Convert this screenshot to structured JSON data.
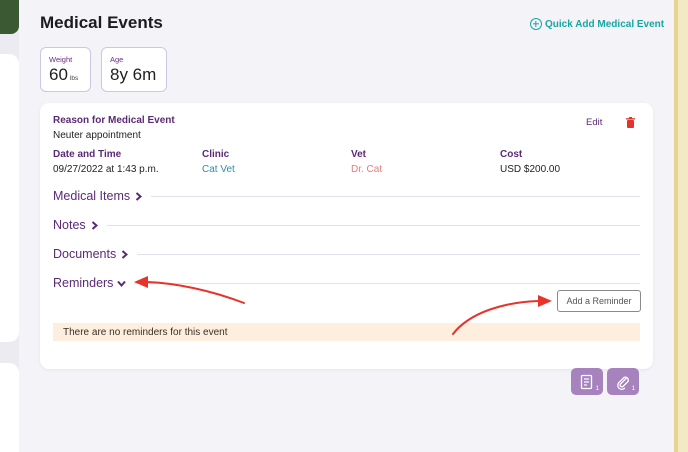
{
  "header": {
    "title": "Medical Events",
    "quick_add_label": "Quick Add Medical Event"
  },
  "stats": {
    "weight": {
      "label": "Weight",
      "value": "60",
      "unit": "lbs"
    },
    "age": {
      "label": "Age",
      "value": "8y 6m"
    }
  },
  "event": {
    "reason_label": "Reason for Medical Event",
    "reason_value": "Neuter appointment",
    "edit_label": "Edit",
    "date_label": "Date and Time",
    "date_value": "09/27/2022 at 1:43 p.m.",
    "clinic_label": "Clinic",
    "clinic_value": "Cat Vet",
    "vet_label": "Vet",
    "vet_value": "Dr. Cat",
    "cost_label": "Cost",
    "cost_value": "USD $200.00"
  },
  "sections": {
    "medical_items": "Medical Items",
    "notes": "Notes",
    "documents": "Documents",
    "reminders": "Reminders"
  },
  "reminders": {
    "add_button": "Add a Reminder",
    "empty_message": "There are no reminders for this event"
  },
  "actions": {
    "notes_count": "1",
    "attachments_count": "1"
  },
  "icons": {
    "quick_add": "plus-circle-icon",
    "delete": "trash-icon",
    "collapsed": "chevron-right-icon",
    "expanded": "chevron-down-icon",
    "notes_action": "notes-icon",
    "attachment_action": "paperclip-icon"
  },
  "colors": {
    "accent_purple": "#5b2a75",
    "teal": "#17a6a3",
    "delete_red": "#e5322d",
    "annotation_red": "#e8332a",
    "action_button": "#a783be",
    "empty_banner": "#fdeedd"
  }
}
